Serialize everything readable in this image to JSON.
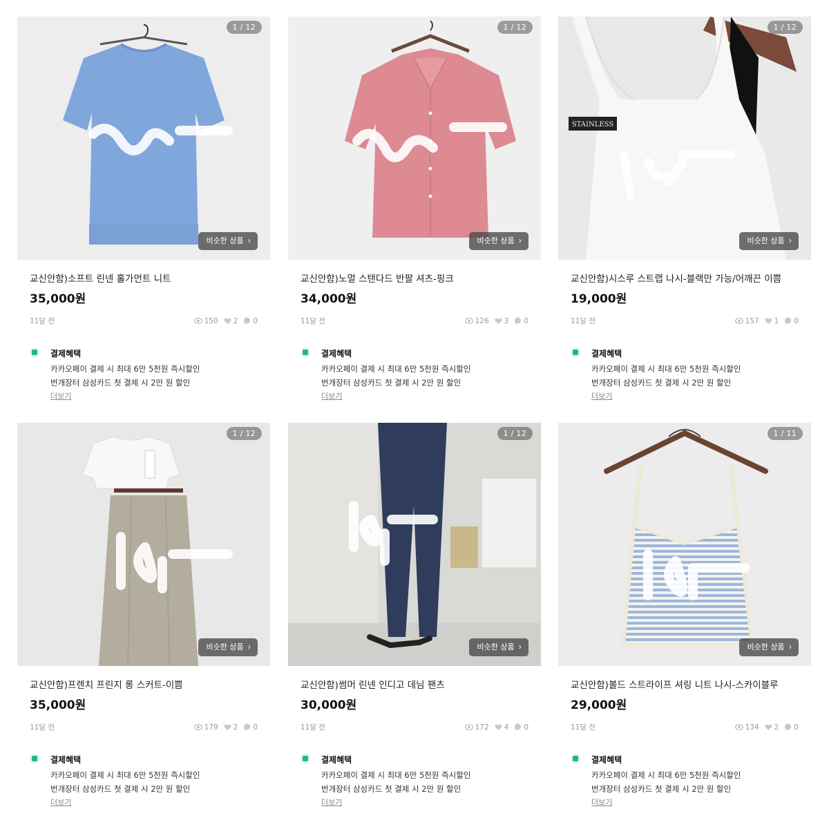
{
  "products": [
    {
      "page_indicator": "1 / 12",
      "similar_label": "비슷한 상품",
      "title": "교신안함)소프트 린넨 홀가먼트 니트",
      "price": "35,000원",
      "time_ago": "11달 전",
      "views": "150",
      "likes": "2",
      "chats": "0",
      "photo_theme": "blue-knit"
    },
    {
      "page_indicator": "1 / 12",
      "similar_label": "비슷한 상품",
      "title": "교신안함)노멀 스탠다드 반팔 셔츠-핑크",
      "price": "34,000원",
      "time_ago": "11달 전",
      "views": "126",
      "likes": "3",
      "chats": "0",
      "photo_theme": "pink-shirt"
    },
    {
      "page_indicator": "1 / 12",
      "similar_label": "비슷한 상품",
      "title": "교신안함)시스루 스트랩 나시-블랙만 가능/어깨끈 이쁨",
      "price": "19,000원",
      "time_ago": "11달 전",
      "views": "157",
      "likes": "1",
      "chats": "0",
      "photo_theme": "white-tank",
      "label_text": "STAINLESS"
    },
    {
      "page_indicator": "1 / 12",
      "similar_label": "비슷한 상품",
      "title": "교신안함)프렌치 프린지 롱 스커트-이쁨",
      "price": "35,000원",
      "time_ago": "11달 전",
      "views": "179",
      "likes": "2",
      "chats": "0",
      "photo_theme": "skirt"
    },
    {
      "page_indicator": "1 / 12",
      "similar_label": "비슷한 상품",
      "title": "교신안함)썸머 린넨 인디고 데님 팬츠",
      "price": "30,000원",
      "time_ago": "11달 전",
      "views": "172",
      "likes": "4",
      "chats": "0",
      "photo_theme": "denim"
    },
    {
      "page_indicator": "1 / 11",
      "similar_label": "비슷한 상품",
      "title": "교신안함)볼드 스트라이프 셔링 니트 나시-스카이블루",
      "price": "29,000원",
      "time_ago": "11달 전",
      "views": "134",
      "likes": "2",
      "chats": "0",
      "photo_theme": "stripe-tank"
    }
  ],
  "benefit": {
    "title": "결제혜택",
    "line1": "카카오페이 결제 시 최대 6만 5천원 즉시할인",
    "line2": "번개장터 삼성카드 첫 결제 시 2만 원  할인",
    "more": "더보기"
  },
  "colors": {
    "pay_green": "#1db980",
    "stat_gray": "#9a9a9a"
  }
}
